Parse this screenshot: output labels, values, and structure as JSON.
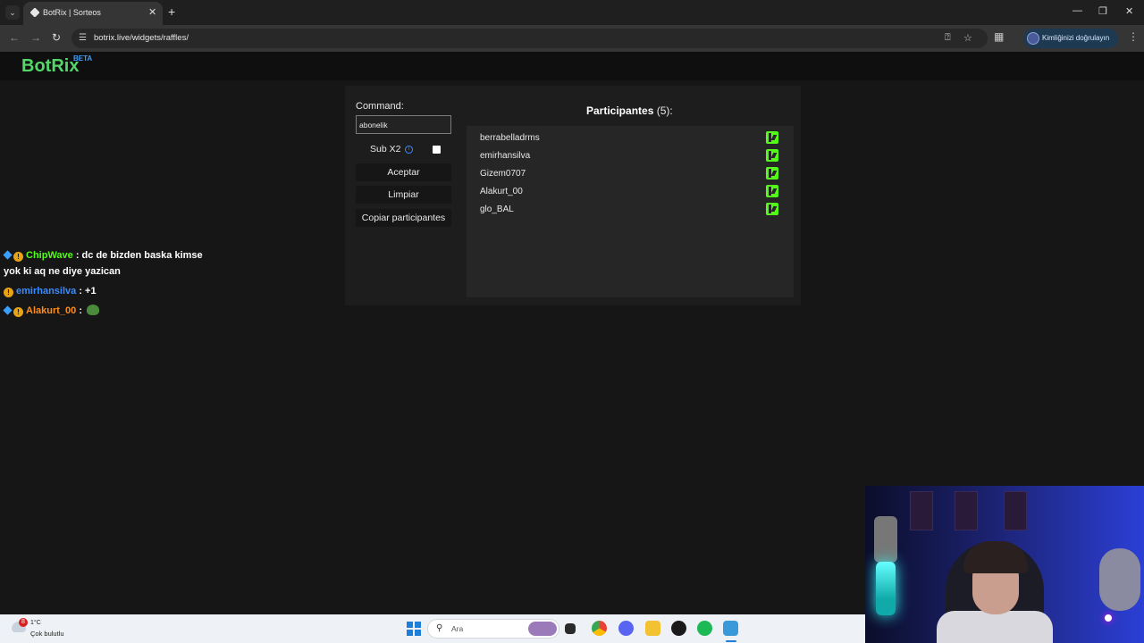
{
  "browser": {
    "tab_title": "BotRix | Sorteos",
    "url": "botrix.live/widgets/raffles/",
    "profile_text": "Kimliğinizi doğrulayın"
  },
  "app": {
    "logo": "BotRix",
    "beta": "BETA"
  },
  "raffle": {
    "command_label": "Command:",
    "command_value": "abonelik",
    "sub_label": "Sub X2",
    "sub_checked": false,
    "accept_label": "Aceptar",
    "clear_label": "Limpiar",
    "copy_label": "Copiar participantes",
    "participants_label": "Participantes",
    "participants_count": "(5):",
    "participants": [
      {
        "name": "berrabelladrms",
        "platform": "kick-icon"
      },
      {
        "name": "emirhansilva",
        "platform": "kick-icon"
      },
      {
        "name": "Gizem0707",
        "platform": "kick-icon"
      },
      {
        "name": "Alakurt_00",
        "platform": "kick-icon"
      },
      {
        "name": "glo_BAL",
        "platform": "kick-icon"
      }
    ]
  },
  "chat": [
    {
      "user": "ChipWave",
      "sep": " : ",
      "text": "dc de bizden baska kimse",
      "text2": "yok ki aq ne diye yazican",
      "color": "#53fc18"
    },
    {
      "user": "emirhansilva",
      "sep": " : ",
      "text": "+1",
      "color": "#3a8cff"
    },
    {
      "user": "Alakurt_00",
      "sep": " : ",
      "text": "",
      "color": "#ff8c1a"
    }
  ],
  "taskbar": {
    "weather_badge": "8",
    "temperature": "1°C",
    "weather_desc": "Çok bulutlu",
    "search_placeholder": "Ara"
  },
  "colors": {
    "brand_green": "#53d769",
    "kick_green": "#53fc18",
    "beta_blue": "#3aa0ff"
  }
}
